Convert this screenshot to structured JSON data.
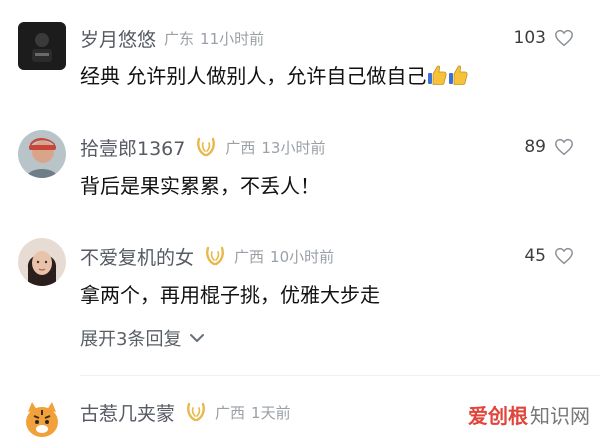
{
  "comments": [
    {
      "username": "岁月悠悠",
      "region": "广东",
      "time": "11小时前",
      "likes": "103",
      "text": "经典  允许别人做别人，允许自己做自己",
      "has_badge": false
    },
    {
      "username": "拾壹郎1367",
      "region": "广西",
      "time": "13小时前",
      "likes": "89",
      "text": "背后是果实累累，不丢人！",
      "has_badge": true
    },
    {
      "username": "不爱复机的女",
      "region": "广西",
      "time": "10小时前",
      "likes": "45",
      "text": "拿两个，再用棍子挑，优雅大步走",
      "has_badge": true,
      "expand_label": "展开3条回复"
    },
    {
      "username": "古惹几夹蒙",
      "region": "广西",
      "time": "1天前",
      "has_badge": true
    }
  ],
  "watermark": {
    "part1": "爱创根",
    "part2": "知识网"
  },
  "colors": {
    "badge": "#e8b84a",
    "name": "#555a63",
    "meta": "#9aa0a6"
  },
  "icons": {
    "like": "heart-outline-icon",
    "badge": "wreath-badge-icon",
    "expand": "chevron-down-icon",
    "thumb": "thumbs-up-emoji-icon"
  }
}
